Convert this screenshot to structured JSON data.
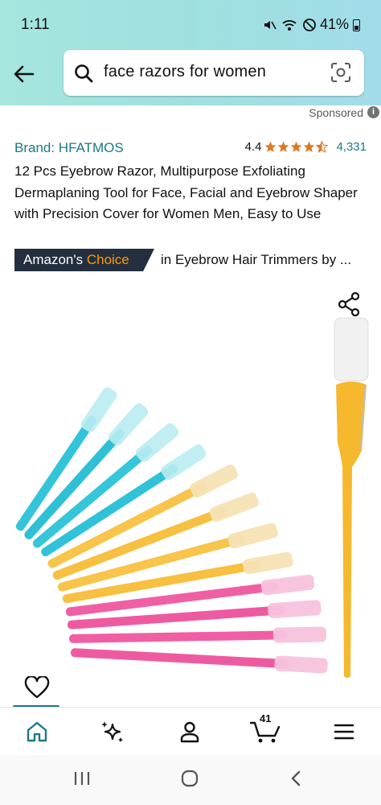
{
  "status_bar": {
    "time": "1:11",
    "battery": "41%"
  },
  "search": {
    "query": "face razors for women"
  },
  "sponsored": {
    "label": "Sponsored",
    "info_icon": "i"
  },
  "product": {
    "brand": "Brand: HFATMOS",
    "rating": "4.4",
    "rating_value": 4.4,
    "review_count": "4,331",
    "title": "12 Pcs Eyebrow Razor, Multipurpose Exfoliating Dermaplaning Tool for Face, Facial and Eyebrow Shaper with Precision Cover for Women Men, Easy to Use",
    "badge": {
      "prefix": "Amazon's ",
      "highlight": "Choice"
    },
    "category": "in Eyebrow Hair Trimmers by ..."
  },
  "bottom_nav": {
    "items": [
      {
        "name": "home",
        "icon": "home-icon",
        "active": true
      },
      {
        "name": "ai-assistant",
        "icon": "sparkle-icon",
        "active": false
      },
      {
        "name": "account",
        "icon": "person-icon",
        "active": false
      },
      {
        "name": "cart",
        "icon": "cart-icon",
        "count": "41",
        "active": false
      },
      {
        "name": "menu",
        "icon": "hamburger-icon",
        "active": false
      }
    ]
  },
  "colors": {
    "accent": "#1b7a86",
    "badge_bg": "#232f3e",
    "badge_orange": "#ff9900",
    "star": "#de7921"
  }
}
